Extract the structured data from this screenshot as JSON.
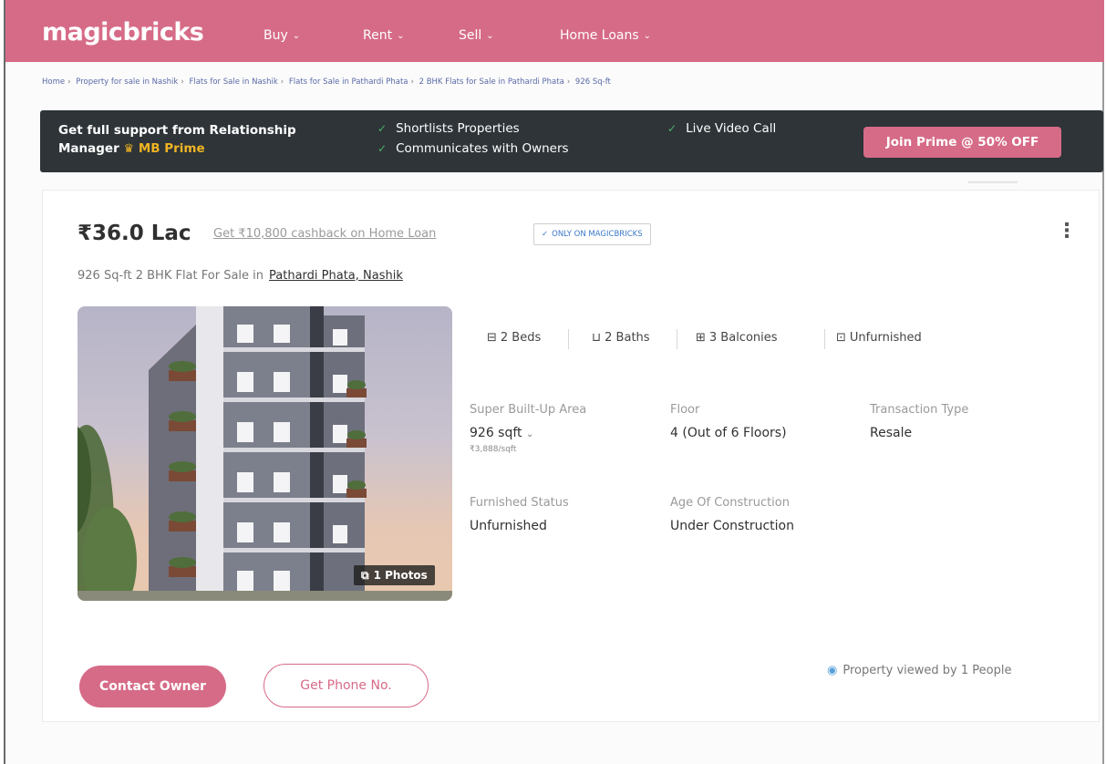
{
  "header": {
    "logo": "magicbricks",
    "nav": [
      {
        "label": "Buy"
      },
      {
        "label": "Rent"
      },
      {
        "label": "Sell"
      },
      {
        "label": "Home Loans"
      }
    ]
  },
  "breadcrumb": [
    "Home",
    "Property for sale in Nashik",
    "Flats for Sale in Nashik",
    "Flats for Sale in Pathardi Phata",
    "2 BHK Flats for Sale in Pathardi Phata",
    "926 Sq-ft"
  ],
  "prime": {
    "title": "Get full support from Relationship Manager",
    "badge": "MB Prime",
    "features": [
      "Shortlists Properties",
      "Communicates with Owners",
      "Live Video Call"
    ],
    "cta": "Join Prime @ 50% OFF"
  },
  "listing": {
    "price": "₹36.0 Lac",
    "cashback": "Get ₹10,800 cashback on Home Loan",
    "badge": "ONLY ON MAGICBRICKS",
    "subtitle": "926 Sq-ft 2 BHK Flat For Sale in",
    "location": "Pathardi Phata, Nashik",
    "photo_count": "1 Photos",
    "amenities": [
      {
        "label": "2 Beds",
        "icon": "bed-icon"
      },
      {
        "label": "2 Baths",
        "icon": "bath-icon"
      },
      {
        "label": "3 Balconies",
        "icon": "balcony-icon"
      },
      {
        "label": "Unfurnished",
        "icon": "furnish-icon"
      }
    ],
    "specs": {
      "area_label": "Super Built-Up Area",
      "area_value": "926 sqft",
      "area_rate": "₹3,888/sqft",
      "floor_label": "Floor",
      "floor_value": "4 (Out of 6 Floors)",
      "txn_label": "Transaction Type",
      "txn_value": "Resale",
      "furnished_label": "Furnished Status",
      "furnished_value": "Unfurnished",
      "age_label": "Age Of Construction",
      "age_value": "Under Construction"
    },
    "contact_button": "Contact Owner",
    "phone_button": "Get Phone No.",
    "views": "Property viewed by 1 People"
  },
  "colors": {
    "brand": "#d66b87",
    "banner": "#2e3438",
    "gold": "#f0b323"
  }
}
